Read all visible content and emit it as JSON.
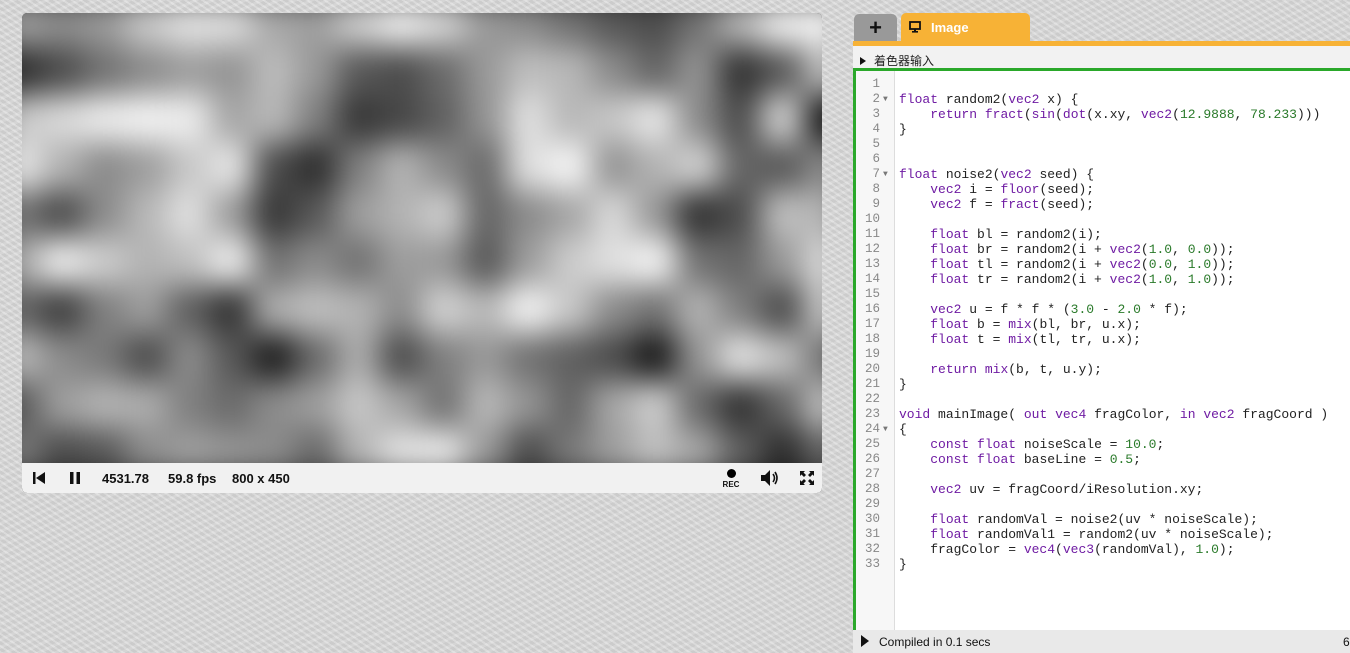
{
  "player": {
    "time": "4531.78",
    "fps": "59.8 fps",
    "resolution": "800 x 450",
    "rec_label": "REC",
    "noise_grid": [
      [
        0.62,
        0.55,
        0.6,
        0.78,
        0.88,
        0.86,
        0.66,
        0.62,
        0.8,
        0.92,
        0.82,
        0.6,
        0.55,
        0.45,
        0.35,
        0.3,
        0.45,
        0.7,
        0.92,
        0.95
      ],
      [
        0.18,
        0.3,
        0.45,
        0.55,
        0.62,
        0.58,
        0.74,
        0.6,
        0.35,
        0.3,
        0.42,
        0.6,
        0.75,
        0.72,
        0.55,
        0.4,
        0.58,
        0.2,
        0.35,
        0.75
      ],
      [
        0.78,
        0.85,
        0.92,
        0.95,
        0.93,
        0.65,
        0.72,
        0.5,
        0.22,
        0.28,
        0.38,
        0.58,
        0.88,
        0.72,
        0.78,
        0.9,
        0.55,
        0.3,
        0.82,
        0.1
      ],
      [
        0.9,
        0.7,
        0.55,
        0.62,
        0.78,
        0.9,
        0.3,
        0.18,
        0.5,
        0.7,
        0.55,
        0.42,
        0.88,
        0.96,
        0.58,
        0.7,
        0.82,
        0.4,
        0.35,
        0.55
      ],
      [
        0.45,
        0.3,
        0.55,
        0.72,
        0.88,
        0.62,
        0.22,
        0.35,
        0.62,
        0.7,
        0.8,
        0.4,
        0.55,
        0.65,
        0.85,
        0.6,
        0.2,
        0.3,
        0.75,
        0.7
      ],
      [
        0.65,
        0.92,
        0.8,
        0.7,
        0.75,
        0.92,
        0.45,
        0.55,
        0.45,
        0.62,
        0.6,
        0.35,
        0.62,
        0.8,
        0.88,
        0.95,
        0.45,
        0.4,
        0.6,
        0.85
      ],
      [
        0.4,
        0.25,
        0.5,
        0.62,
        0.38,
        0.2,
        0.68,
        0.75,
        0.7,
        0.55,
        0.82,
        0.72,
        0.95,
        0.78,
        0.55,
        0.45,
        0.7,
        0.5,
        0.3,
        0.78
      ],
      [
        0.72,
        0.55,
        0.48,
        0.3,
        0.55,
        0.35,
        0.12,
        0.42,
        0.68,
        0.3,
        0.5,
        0.6,
        0.45,
        0.38,
        0.3,
        0.1,
        0.58,
        0.88,
        0.75,
        0.45
      ],
      [
        0.35,
        0.62,
        0.7,
        0.68,
        0.5,
        0.42,
        0.55,
        0.62,
        0.78,
        0.65,
        0.45,
        0.72,
        0.58,
        0.4,
        0.65,
        0.8,
        0.42,
        0.2,
        0.4,
        0.75
      ],
      [
        0.48,
        0.3,
        0.35,
        0.55,
        0.62,
        0.58,
        0.55,
        0.42,
        0.7,
        0.88,
        0.9,
        0.6,
        0.3,
        0.48,
        0.62,
        0.75,
        0.65,
        0.38,
        0.18,
        0.4
      ]
    ]
  },
  "editor": {
    "add_tab_label": "+",
    "tab_label": "Image",
    "inputs_label": "着色器输入",
    "status_text": "Compiled in 0.1 secs",
    "status_count": "6",
    "code_lines": [
      {
        "n": "1",
        "fold": false,
        "t": ""
      },
      {
        "n": "2",
        "fold": true,
        "t": "float random2(vec2 x) {"
      },
      {
        "n": "3",
        "fold": false,
        "t": "    return fract(sin(dot(x.xy, vec2(12.9888, 78.233)))"
      },
      {
        "n": "4",
        "fold": false,
        "t": "}"
      },
      {
        "n": "5",
        "fold": false,
        "t": ""
      },
      {
        "n": "6",
        "fold": false,
        "t": ""
      },
      {
        "n": "7",
        "fold": true,
        "t": "float noise2(vec2 seed) {"
      },
      {
        "n": "8",
        "fold": false,
        "t": "    vec2 i = floor(seed);"
      },
      {
        "n": "9",
        "fold": false,
        "t": "    vec2 f = fract(seed);"
      },
      {
        "n": "10",
        "fold": false,
        "t": ""
      },
      {
        "n": "11",
        "fold": false,
        "t": "    float bl = random2(i);"
      },
      {
        "n": "12",
        "fold": false,
        "t": "    float br = random2(i + vec2(1.0, 0.0));"
      },
      {
        "n": "13",
        "fold": false,
        "t": "    float tl = random2(i + vec2(0.0, 1.0));"
      },
      {
        "n": "14",
        "fold": false,
        "t": "    float tr = random2(i + vec2(1.0, 1.0));"
      },
      {
        "n": "15",
        "fold": false,
        "t": ""
      },
      {
        "n": "16",
        "fold": false,
        "t": "    vec2 u = f * f * (3.0 - 2.0 * f);"
      },
      {
        "n": "17",
        "fold": false,
        "t": "    float b = mix(bl, br, u.x);"
      },
      {
        "n": "18",
        "fold": false,
        "t": "    float t = mix(tl, tr, u.x);"
      },
      {
        "n": "19",
        "fold": false,
        "t": ""
      },
      {
        "n": "20",
        "fold": false,
        "t": "    return mix(b, t, u.y);"
      },
      {
        "n": "21",
        "fold": false,
        "t": "}"
      },
      {
        "n": "22",
        "fold": false,
        "t": ""
      },
      {
        "n": "23",
        "fold": false,
        "t": "void mainImage( out vec4 fragColor, in vec2 fragCoord )"
      },
      {
        "n": "24",
        "fold": true,
        "t": "{"
      },
      {
        "n": "25",
        "fold": false,
        "t": "    const float noiseScale = 10.0;"
      },
      {
        "n": "26",
        "fold": false,
        "t": "    const float baseLine = 0.5;"
      },
      {
        "n": "27",
        "fold": false,
        "t": ""
      },
      {
        "n": "28",
        "fold": false,
        "t": "    vec2 uv = fragCoord/iResolution.xy;"
      },
      {
        "n": "29",
        "fold": false,
        "t": ""
      },
      {
        "n": "30",
        "fold": false,
        "t": "    float randomVal = noise2(uv * noiseScale);"
      },
      {
        "n": "31",
        "fold": false,
        "t": "    float randomVal1 = random2(uv * noiseScale);"
      },
      {
        "n": "32",
        "fold": false,
        "t": "    fragColor = vec4(vec3(randomVal), 1.0);"
      },
      {
        "n": "33",
        "fold": false,
        "t": "}"
      }
    ]
  },
  "colors": {
    "accent": "#f7b236",
    "border_green": "#2aa82a",
    "keyword": "#6f1ba3",
    "number": "#2a7a2a"
  }
}
